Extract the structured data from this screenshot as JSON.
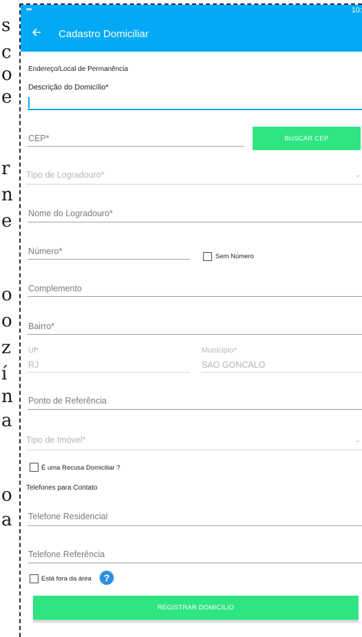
{
  "background_letters": [
    "s",
    "c",
    "o",
    "e",
    "r",
    "n",
    "e",
    "o",
    "o",
    "z",
    "í",
    "n",
    "a",
    "o",
    "a"
  ],
  "status_bar": {
    "time": "10:"
  },
  "app_bar": {
    "title": "Cadastro Domiciliar",
    "back_icon": "arrow-left-icon"
  },
  "form": {
    "section_address": "Endereço/Local de Permanência",
    "descricao_label": "Descrição do Domicílio*",
    "cep_label": "CEP*",
    "buscar_cep": "BUSCAR CEP",
    "tipo_logradouro_label": "Tipo de Logradouro*",
    "nome_logradouro_label": "Nome do Logradouro*",
    "numero_label": "Número*",
    "sem_numero_label": "Sem Número",
    "complemento_label": "Complemento",
    "bairro_label": "Bairro*",
    "uf_label": "Uf*",
    "uf_value": "RJ",
    "municipio_label": "Municipio*",
    "municipio_value": "SAO GONCALO",
    "ponto_referencia_label": "Ponto de Referência",
    "tipo_imovel_label": "Tipo de Imóvel*",
    "recusa_label": "É uma Recusa Domiciliar ?",
    "section_phones": "Telefones para Contato",
    "telefone_residencial_label": "Telefone Residencial",
    "telefone_referencia_label": "Telefone Referência",
    "fora_area_label": "Está fora da área",
    "help_icon": "?",
    "registrar_button": "REGISTRAR DOMICÍLIO"
  },
  "colors": {
    "primary": "#03a9f4",
    "accent_green": "#2ee582",
    "help_blue": "#2f8ee0"
  }
}
